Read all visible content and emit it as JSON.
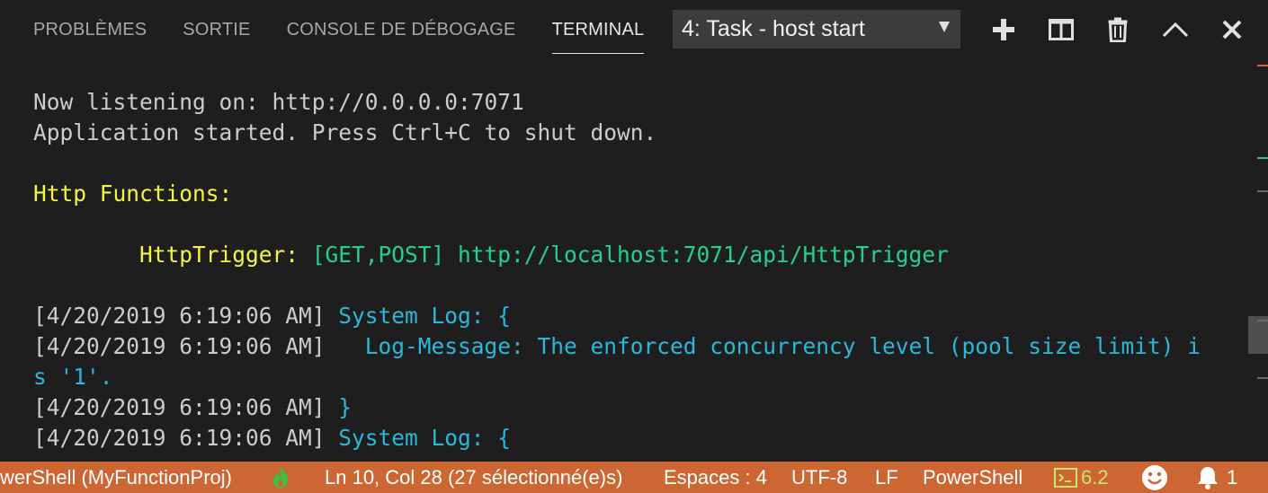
{
  "panel": {
    "tabs": [
      {
        "label": "PROBLÈMES",
        "active": false
      },
      {
        "label": "SORTIE",
        "active": false
      },
      {
        "label": "CONSOLE DE DÉBOGAGE",
        "active": false
      },
      {
        "label": "TERMINAL",
        "active": true
      }
    ],
    "terminal_select": {
      "value": "4: Task - host start"
    },
    "actions": [
      {
        "icon": "plus-icon"
      },
      {
        "icon": "split-icon"
      },
      {
        "icon": "trash-icon"
      },
      {
        "icon": "chevron-up-icon"
      },
      {
        "icon": "close-icon"
      }
    ]
  },
  "terminal": {
    "lines": [
      {
        "segments": [
          {
            "text": "Now listening on: http://0.0.0.0:7071",
            "color": "#cccccc"
          }
        ]
      },
      {
        "segments": [
          {
            "text": "Application started. Press Ctrl+C to shut down.",
            "color": "#cccccc"
          }
        ]
      },
      {
        "segments": []
      },
      {
        "segments": [
          {
            "text": "Http Functions:",
            "color": "#f5f543"
          }
        ]
      },
      {
        "segments": []
      },
      {
        "segments": [
          {
            "text": "        HttpTrigger:",
            "color": "#f5f543"
          },
          {
            "text": " [GET,POST]",
            "color": "#23d18b"
          },
          {
            "text": " http://localhost:7071/api/HttpTrigger",
            "color": "#23d18b"
          }
        ]
      },
      {
        "segments": []
      },
      {
        "segments": [
          {
            "text": "[4/20/2019 6:19:06 AM]",
            "color": "#cccccc"
          },
          {
            "text": " System Log: {",
            "color": "#29b8db"
          }
        ]
      },
      {
        "segments": [
          {
            "text": "[4/20/2019 6:19:06 AM]",
            "color": "#cccccc"
          },
          {
            "text": "   Log-Message: The enforced concurrency level (pool size limit) i",
            "color": "#29b8db"
          }
        ]
      },
      {
        "segments": [
          {
            "text": "s '1'.",
            "color": "#29b8db"
          }
        ]
      },
      {
        "segments": [
          {
            "text": "[4/20/2019 6:19:06 AM]",
            "color": "#cccccc"
          },
          {
            "text": " }",
            "color": "#29b8db"
          }
        ]
      },
      {
        "segments": [
          {
            "text": "[4/20/2019 6:19:06 AM]",
            "color": "#cccccc"
          },
          {
            "text": " System Log: {",
            "color": "#29b8db"
          }
        ]
      }
    ]
  },
  "status_bar": {
    "shell": "werShell (MyFunctionProj)",
    "flame_icon": "flame-icon",
    "position": "Ln 10, Col 28 (27 sélectionné(e)s)",
    "spaces": "Espaces : 4",
    "encoding": "UTF-8",
    "eol": "LF",
    "language": "PowerShell",
    "ps_version": "6.2",
    "notifications": "1",
    "colors": {
      "background": "#cc6633",
      "flame": "#3fbf3f",
      "version": "#c8e66b"
    }
  }
}
